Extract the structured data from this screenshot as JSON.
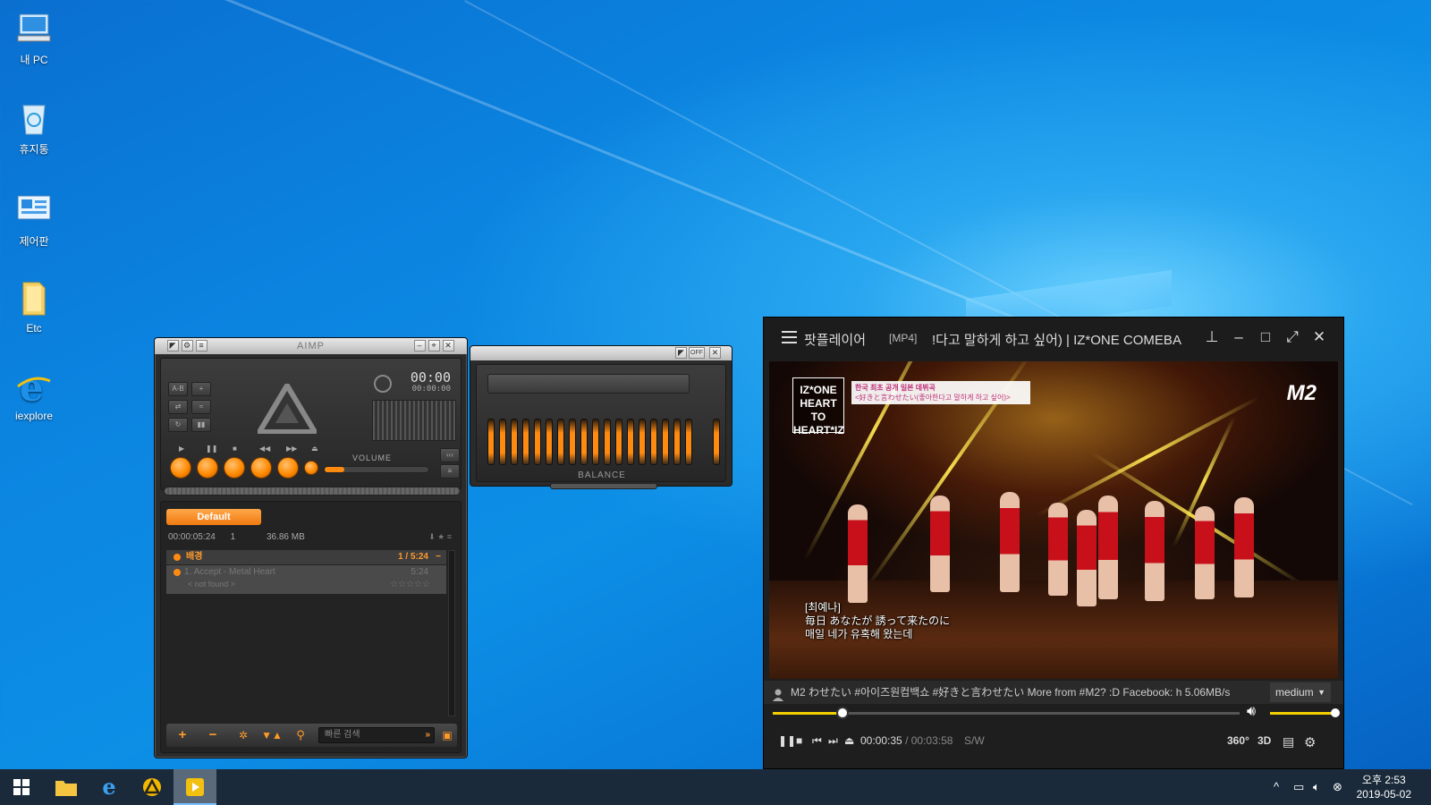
{
  "desktop": {
    "icons": [
      {
        "label": "내 PC",
        "icon": "computer-icon"
      },
      {
        "label": "휴지통",
        "icon": "recycle-bin-icon"
      },
      {
        "label": "제어판",
        "icon": "control-panel-icon"
      },
      {
        "label": "Etc",
        "icon": "folder-icon"
      },
      {
        "label": "iexplore",
        "icon": "internet-explorer-icon"
      }
    ]
  },
  "aimp": {
    "title": "AIMP",
    "time_main": "00:00",
    "time_sub": "00:00:00",
    "volume_label": "VOLUME",
    "playlist_tab": "Default",
    "playlist_duration": "00:00:05:24",
    "playlist_count": "1",
    "playlist_size": "36.86 MB",
    "group_name": "배경",
    "group_info": "1 / 5:24",
    "track_title": "1. Accept - Metal Heart",
    "track_time": "5:24",
    "track_status": "< not found >",
    "search_placeholder": "빠른 검색"
  },
  "equalizer": {
    "off_label": "OFF",
    "balance_label": "BALANCE",
    "bands": [
      0.6,
      0.62,
      0.6,
      0.61,
      0.6,
      0.62,
      0.6,
      0.6,
      0.61,
      0.6,
      0.62,
      0.6,
      0.61,
      0.6,
      0.62,
      0.6,
      0.61,
      0.6
    ],
    "accent_color": "#ff8a10"
  },
  "potplayer": {
    "app_name": "팟플레이어",
    "format": "[MP4]",
    "title": "!다고 말하게 하고 싶어) | IZ*ONE COMEBA",
    "video_badge_left": "IZ*ONE HEART TO HEART*IZ",
    "video_badge_top_1": "한국 최초 공개 일본 데뷔곡",
    "video_badge_top_2": "<好きと言わせたい(좋아한다고 말하게 하고 싶어)>",
    "video_badge_right": "M2",
    "subtitle_1": "[최예나]",
    "subtitle_2": "毎日 あなたが 誘って来たのに",
    "subtitle_3": "매일 네가 유혹해 왔는데",
    "ticker_text": "M2 わせたい  #아이즈원컴백쇼 #好きと言わせたい  More from #M2? :D  Facebook:  h 5.06MB/s",
    "quality": "medium",
    "time_current": "00:00:35",
    "time_separator": "/",
    "time_total": "00:03:58",
    "sw_label": "S/W",
    "label_360": "360°",
    "label_3d": "3D",
    "progress_fraction": 0.15,
    "volume_fraction": 1.0,
    "accent_color": "#f4d000"
  },
  "taskbar": {
    "clock_time": "오후 2:53",
    "clock_date": "2019-05-02"
  }
}
